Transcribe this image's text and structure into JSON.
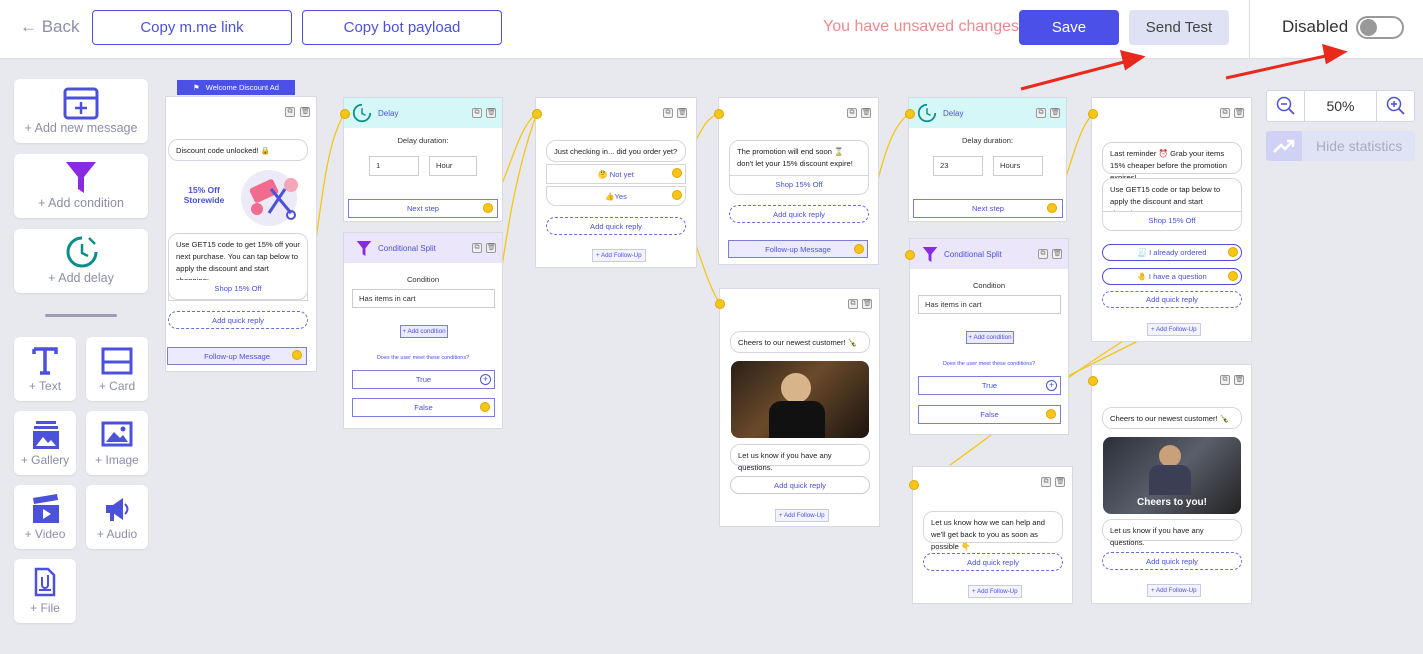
{
  "topbar": {
    "back": "← Back",
    "copy_mme": "Copy m.me link",
    "copy_payload": "Copy bot payload",
    "unsaved": "You have unsaved changes.",
    "save": "Save",
    "send_test": "Send Test",
    "status_label": "Disabled",
    "toggle_on": false
  },
  "toolbox": {
    "add_message": "+ Add new message",
    "add_condition": "+ Add condition",
    "add_delay": "+ Add delay",
    "text": "+ Text",
    "card": "+ Card",
    "gallery": "+ Gallery",
    "image": "+ Image",
    "video": "+ Video",
    "audio": "+ Audio",
    "file": "+ File"
  },
  "zoom": {
    "level": "50%",
    "hide_stats": "Hide statistics"
  },
  "colors": {
    "accent": "#4b51e8",
    "connector": "#f5c518",
    "delay_bg": "#d6f7f7",
    "cond_bg": "#ece6fb",
    "unsaved": "#f0888e"
  },
  "nodes": {
    "welcome": {
      "tag": "Welcome Discount Ad",
      "msg1": "Discount code unlocked! 🔒",
      "img_text": "15% Off Storewide",
      "msg2": "Use GET15 code to get 15% off your next purchase. You can tap below to apply the discount and start shopping:",
      "shop": "Shop 15% Off",
      "quick_reply": "Add quick reply",
      "followup": "Follow-up Message"
    },
    "delay1": {
      "title": "Delay",
      "label": "Delay duration:",
      "value": "1",
      "unit": "Hour",
      "next": "Next step"
    },
    "cond1": {
      "title": "Conditional Split",
      "label": "Condition",
      "select": "Has items in cart",
      "add": "+ Add condition",
      "question": "Does the user meet these conditions?",
      "true": "True",
      "false": "False"
    },
    "checkin": {
      "msg": "Just checking in... did you order yet?",
      "opt1": "🤔 Not yet",
      "opt2": "👍Yes",
      "quick_reply": "Add quick reply",
      "addfu": "+ Add Follow-Up"
    },
    "promo": {
      "msg": "The promotion will end soon ⌛ don't let your 15% discount expire!",
      "shop": "Shop 15% Off",
      "quick_reply": "Add quick reply",
      "followup": "Follow-up Message"
    },
    "cheers1": {
      "msg1": "Cheers to our newest customer! 🍾",
      "msg2": "Let us know if you have any questions.",
      "quick_reply": "Add quick reply",
      "addfu": "+ Add Follow-Up"
    },
    "delay2": {
      "title": "Delay",
      "label": "Delay duration:",
      "value": "23",
      "unit": "Hours",
      "next": "Next step"
    },
    "cond2": {
      "title": "Conditional Split",
      "label": "Condition",
      "select": "Has items in cart",
      "add": "+ Add condition",
      "question": "Does the user meet these conditions?",
      "true": "True",
      "false": "False"
    },
    "help": {
      "msg": "Let us know how we can help and we'll get back to you as soon as possible 👇",
      "quick_reply": "Add quick reply",
      "addfu": "+ Add Follow-Up"
    },
    "reminder": {
      "msg1": "Last reminder ⏰ Grab your items 15% cheaper before the promotion expires!",
      "msg2": "Use GET15 code or tap below to apply the discount and start shopping:",
      "shop": "Shop 15% Off",
      "opt1": "🧾 I already ordered",
      "opt2": "🤚 I have a question",
      "quick_reply": "Add quick reply",
      "addfu": "+ Add Follow-Up"
    },
    "cheers2": {
      "msg1": "Cheers to our newest customer! 🍾",
      "gif_caption": "Cheers to you!",
      "msg2": "Let us know if you have any questions.",
      "quick_reply": "Add quick reply",
      "addfu": "+ Add Follow-Up"
    }
  }
}
